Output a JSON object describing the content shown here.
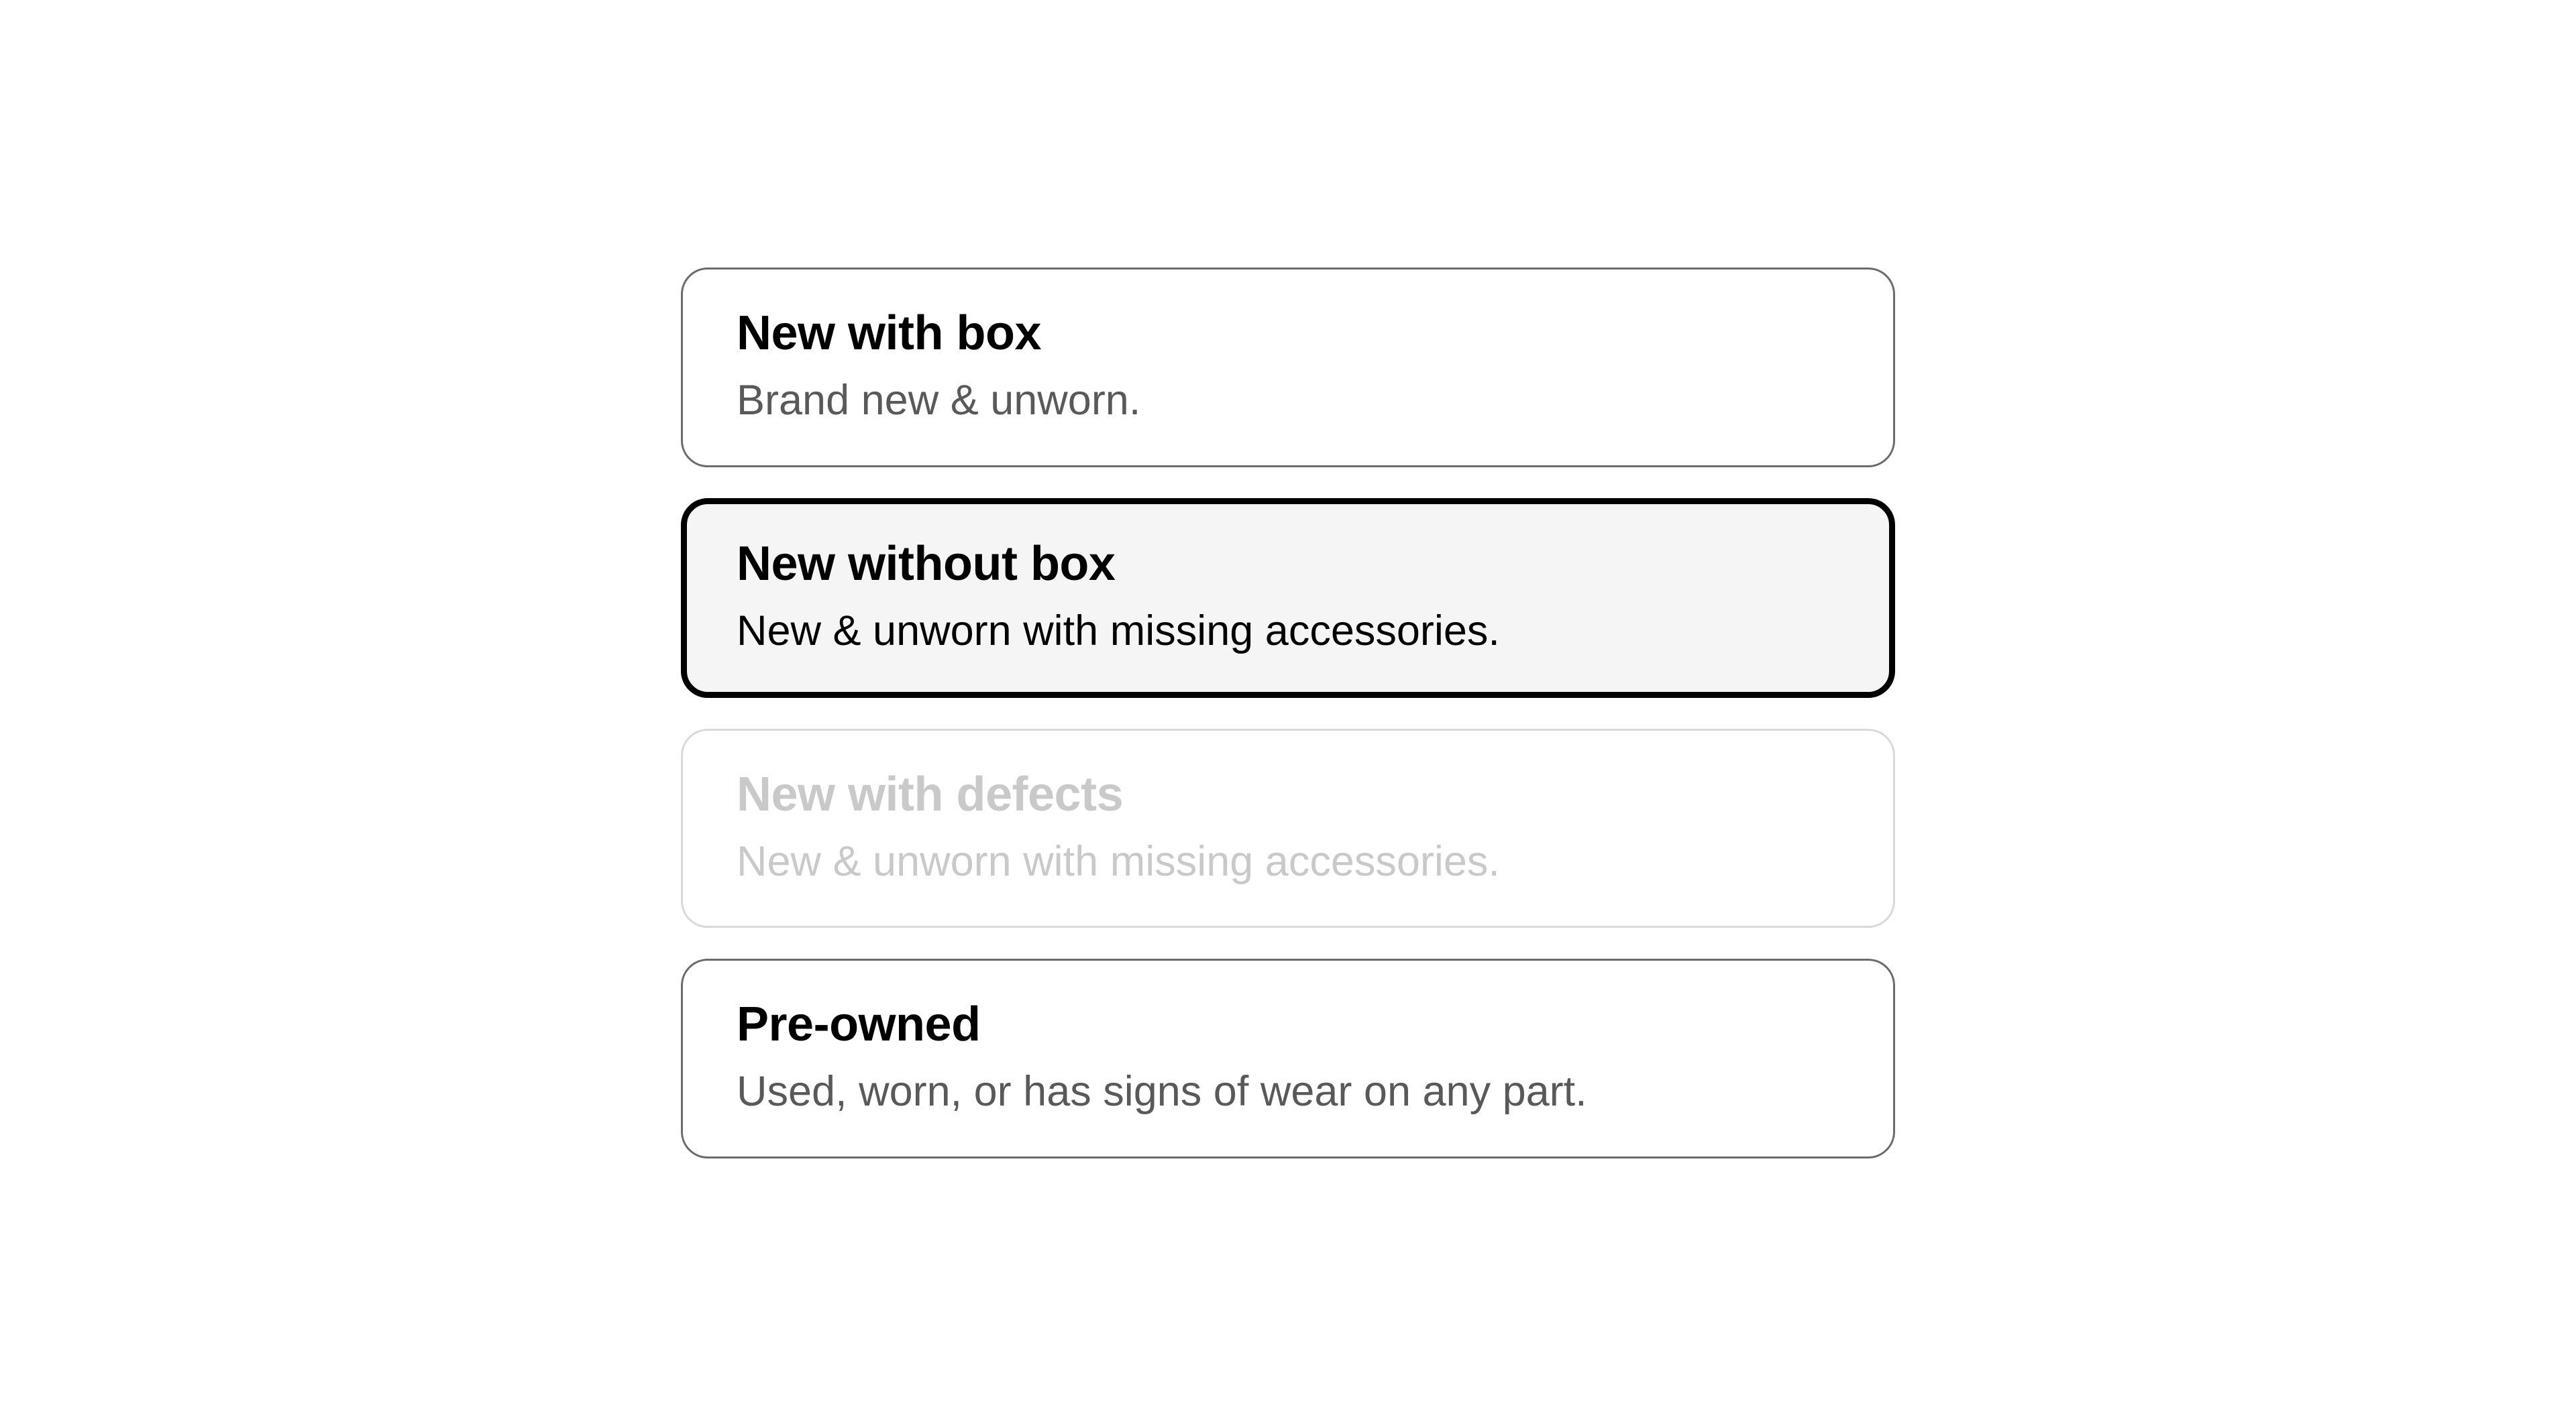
{
  "options": [
    {
      "title": "New with box",
      "description": "Brand new & unworn.",
      "state": "default"
    },
    {
      "title": "New without box",
      "description": "New & unworn with missing accessories.",
      "state": "selected"
    },
    {
      "title": "New with defects",
      "description": "New & unworn with missing accessories.",
      "state": "disabled"
    },
    {
      "title": "Pre-owned",
      "description": "Used, worn, or has signs of wear on any part.",
      "state": "default"
    }
  ]
}
